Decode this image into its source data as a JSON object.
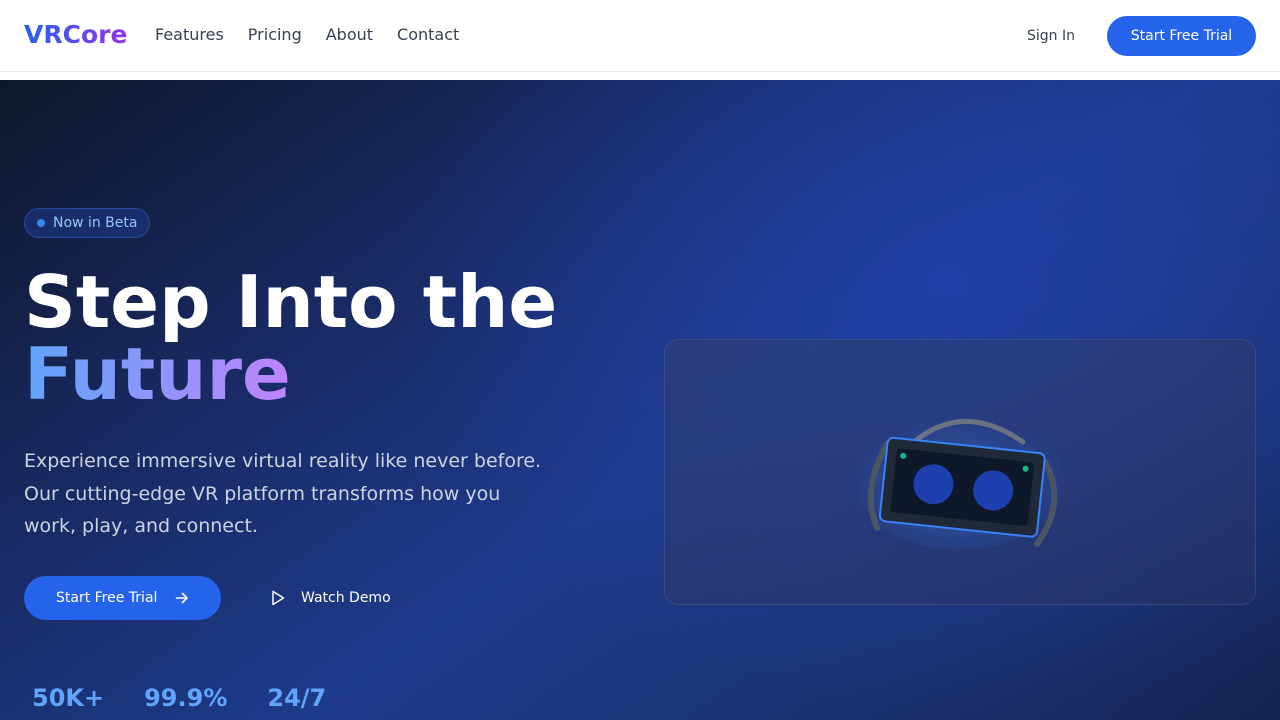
{
  "nav": {
    "logo": "VRCore",
    "links": [
      "Features",
      "Pricing",
      "About",
      "Contact"
    ],
    "sign_in": "Sign In",
    "cta": "Start Free Trial"
  },
  "hero": {
    "badge": "Now in Beta",
    "title_line1": "Step Into the",
    "title_line2": "Future",
    "subtitle": "Experience immersive virtual reality like never before. Our cutting-edge VR platform transforms how you work, play, and connect.",
    "primary_cta": "Start Free Trial",
    "secondary_cta": "Watch Demo",
    "stats": [
      "50K+",
      "99.9%",
      "24/7"
    ]
  },
  "icons": {
    "cta_arrow": "arrow-right-icon",
    "demo": "play-icon",
    "visual": "vr-headset-icon"
  },
  "colors": {
    "accent": "#2563eb",
    "gradient_start": "#60a5fa",
    "gradient_end": "#c084fc",
    "stat": "#60a5fa"
  }
}
